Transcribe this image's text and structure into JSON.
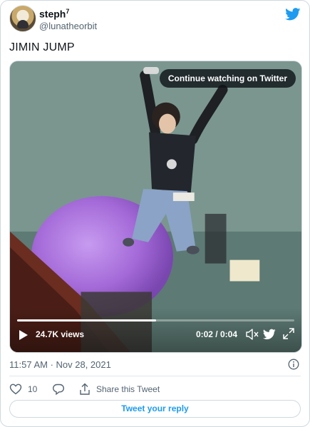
{
  "author": {
    "name": "steph",
    "name_superscript": "7",
    "handle": "@lunatheorbit"
  },
  "tweet": {
    "text": "JIMIN JUMP"
  },
  "video": {
    "continue_label": "Continue watching on Twitter",
    "views": "24.7K views",
    "time": "0:02 / 0:04",
    "progress_fraction": 0.5
  },
  "meta": {
    "timestamp": "11:57 AM · Nov 28, 2021"
  },
  "actions": {
    "like_count": "10",
    "share_label": "Share this Tweet",
    "reply_button": "Tweet your reply"
  },
  "icons": {
    "brand": "twitter-bird-icon",
    "info": "info-icon",
    "like": "heart-icon",
    "reply": "reply-icon",
    "share": "share-icon",
    "play": "play-icon",
    "volume": "volume-icon",
    "expand": "expand-icon"
  },
  "colors": {
    "brand": "#1d9bf0",
    "text": "#0f1419",
    "muted": "#536471"
  }
}
